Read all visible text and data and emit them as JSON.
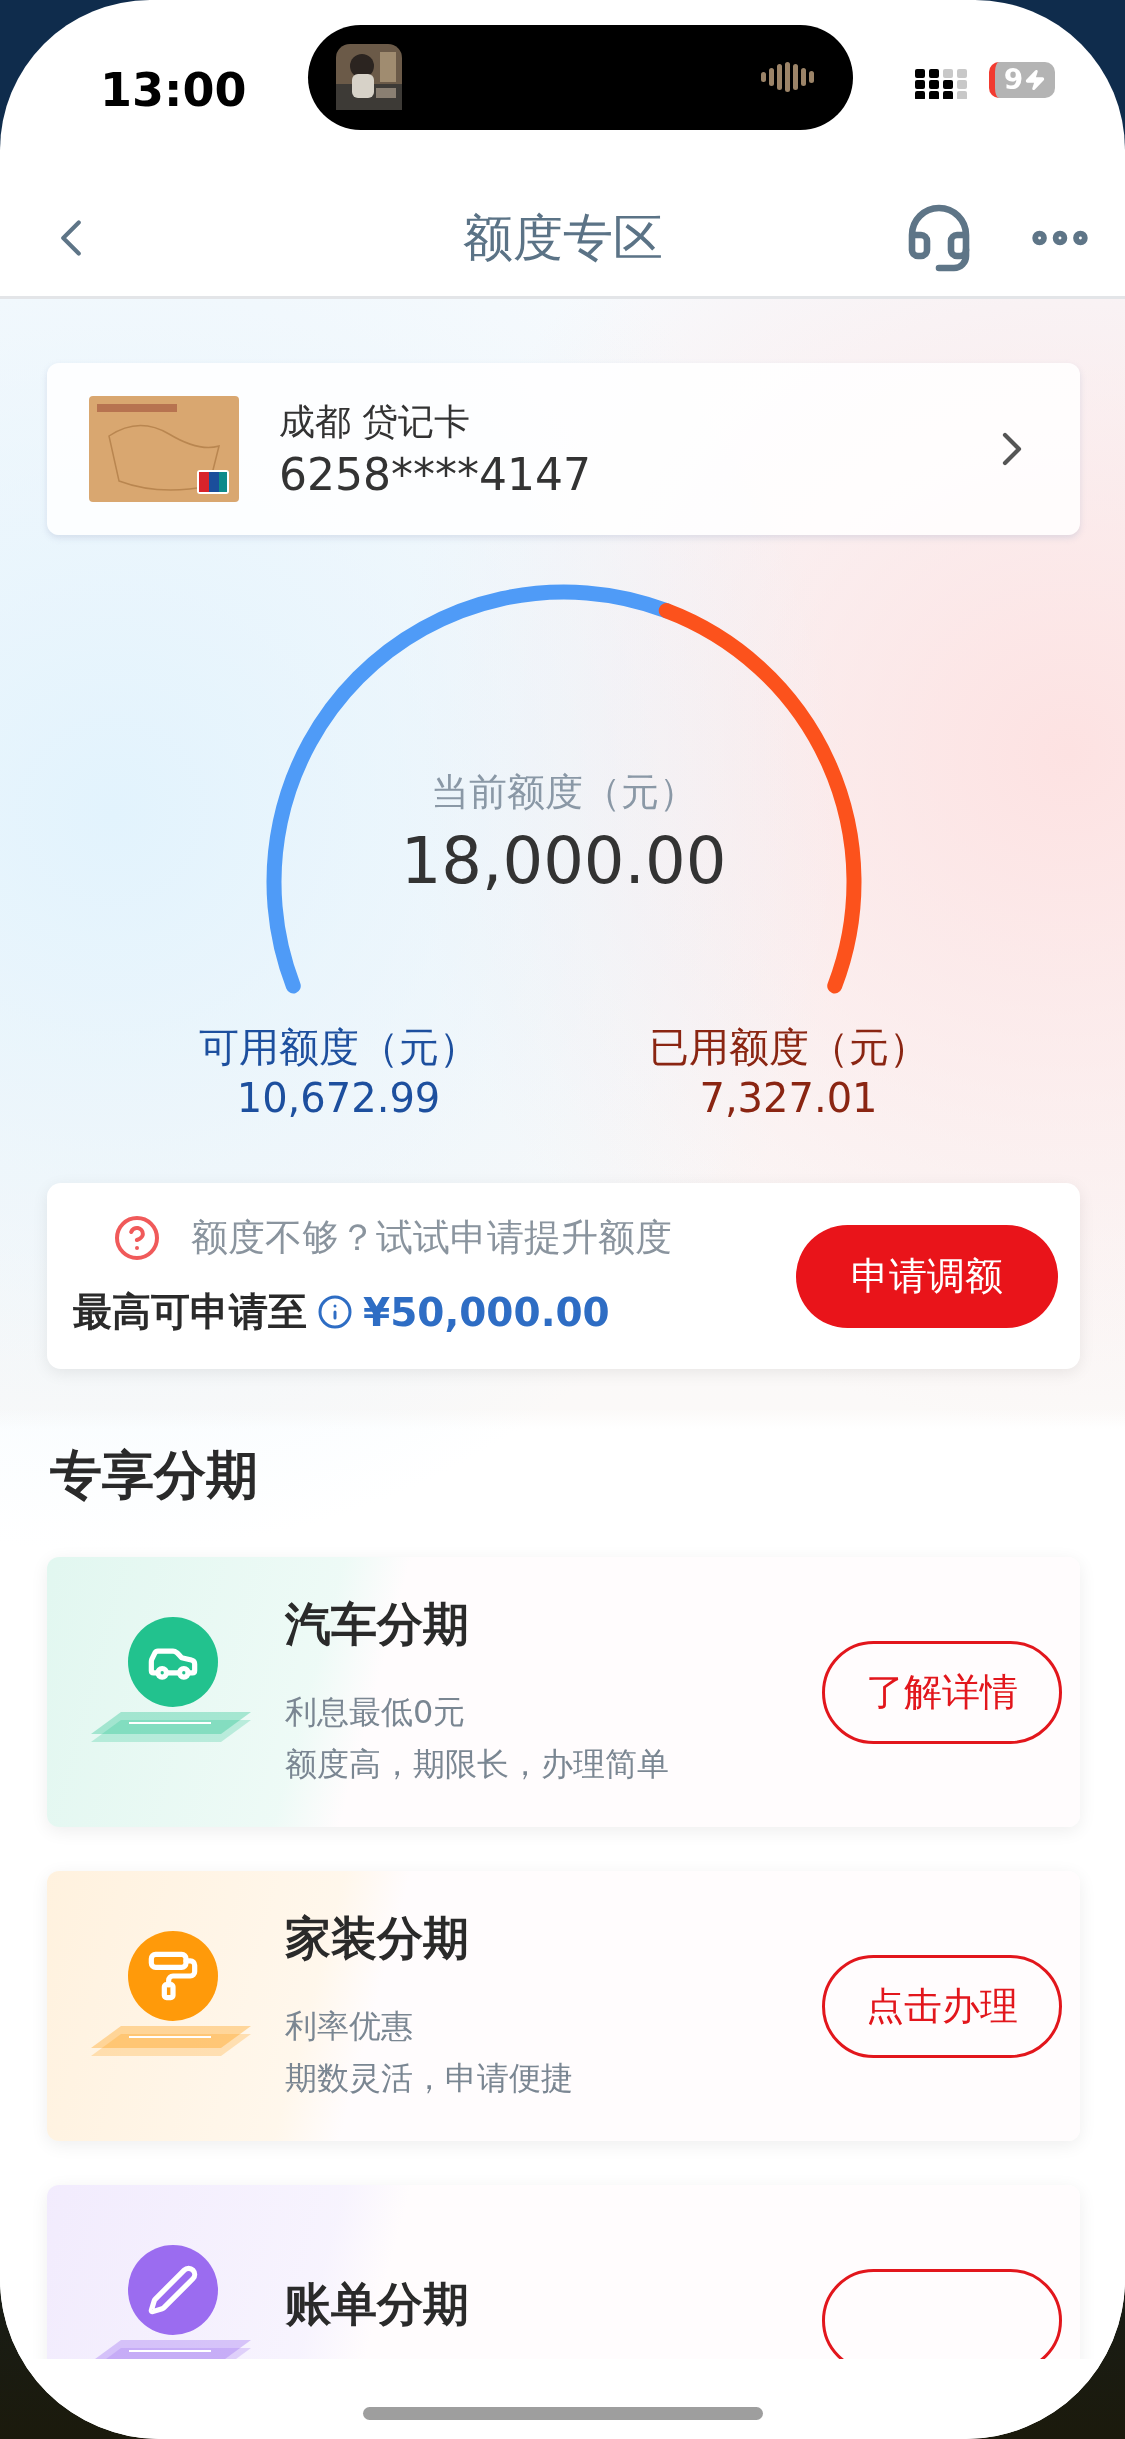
{
  "status_bar": {
    "time": "13:00",
    "battery": "9"
  },
  "nav": {
    "title": "额度专区"
  },
  "card": {
    "name": "成都 贷记卡",
    "number": "6258****4147"
  },
  "gauge": {
    "label": "当前额度（元）",
    "amount": "18,000.00",
    "available": {
      "label": "可用额度（元）",
      "value": "10,672.99"
    },
    "used": {
      "label": "已用额度（元）",
      "value": "7,327.01"
    }
  },
  "apply": {
    "hint": "额度不够？试试申请提升额度",
    "max_label": "最高可申请至",
    "max_value": "¥50,000.00",
    "button": "申请调额"
  },
  "section_title": "专享分期",
  "products": [
    {
      "title": "汽车分期",
      "lines": [
        "利息最低0元",
        "额度高，期限长，办理简单"
      ],
      "button": "了解详情",
      "color": "#22c28e"
    },
    {
      "title": "家装分期",
      "lines": [
        "利率优惠",
        "期数灵活，申请便捷"
      ],
      "button": "点击办理",
      "color": "#ff9a0a"
    },
    {
      "title": "账单分期",
      "color": "#9b6cf0"
    }
  ]
}
